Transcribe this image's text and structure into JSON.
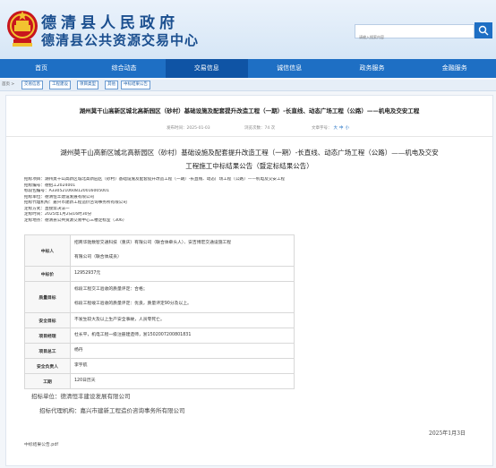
{
  "header": {
    "title": "德清县人民政府",
    "subtitle": "德清县公共资源交易中心",
    "search_placeholder": "请输入搜索内容"
  },
  "nav": {
    "items": [
      "首页",
      "综合动态",
      "交易信息",
      "诚信信息",
      "政务服务",
      "金融服务"
    ],
    "active": "交易信息"
  },
  "breadcrumb": {
    "home": "首页 >",
    "items": [
      "交易信息",
      "工程建设",
      "项目类型",
      "其他",
      "中标结果公告"
    ]
  },
  "article": {
    "title": "湖州莫干山高新区城北高新园区（砂村）基础设施及配套提升改造工程（一期）-长直线、动态广场工程（公路）——机电及交安工程",
    "publish_time": "发布时间：2025-01-03",
    "views": "浏览次数：74 次",
    "font_size_label": "文章字号：",
    "font_sizes": [
      "大",
      "中",
      "小"
    ],
    "heading_line1": "湖州莫干山高新区城北高新园区（砂村）基础设施及配套提升改造工程（一期）-长直线、动态广场工程（公路）——机电及交安",
    "heading_line2": "工程施工中标结果公告（暨定标结果公告）",
    "info_lines": [
      "招标项目：湖州莫干山高新区城北高新园区（砂村）基础设施及配套提升改造工程（一期）-长直线、动态广场工程（公路）——机电及交安工程",
      "招标编号：德招工2024001",
      "标段包编号：A3305210608120016005001",
      "招标单位：德清恒丰建设发展有限公司",
      "招标代理机构：嘉兴市建新工程造价咨询事务所有限公司",
      "定标方式：直接票决法一",
      "定标时间：2025年1月2日16时30分",
      "定标地点：德清县公共资源交易中心三楼定标室（306）"
    ],
    "table": {
      "bidder_label": "中标人",
      "bidder_line1": "招商华驰数智交通科技（重庆）有限公司（联合体牵头人）、安吉博宏交通设施工程",
      "bidder_line2": "有限公司（联合体成员）",
      "price_label": "中标价",
      "price": "12952937元",
      "quality_label": "质量目标",
      "quality_line1": "标段工程交工验收的质量评定：合格；",
      "quality_line2": "标段工程竣工验收的质量评定：优良，质量评定90分及以上。",
      "safety_label": "安全目标",
      "safety": "不发生较大及以上生产安全事故，人员零死亡。",
      "manager_label": "项目经理",
      "manager": "杜长平，机电工程一级注册建造师，浙1502007200801831",
      "chief_label": "项目总工",
      "chief": "杨丹",
      "safety_officer_label": "安全负责人",
      "safety_officer": "李宇航",
      "period_label": "工期",
      "period": "120日历天"
    },
    "tenderer": "招标单位：德清恒丰建设发展有限公司",
    "agency": "招标代理机构：嘉兴市建新工程造价咨询事务所有限公司",
    "date": "2025年1月3日",
    "attachment": "中标结果公告.pdf"
  }
}
